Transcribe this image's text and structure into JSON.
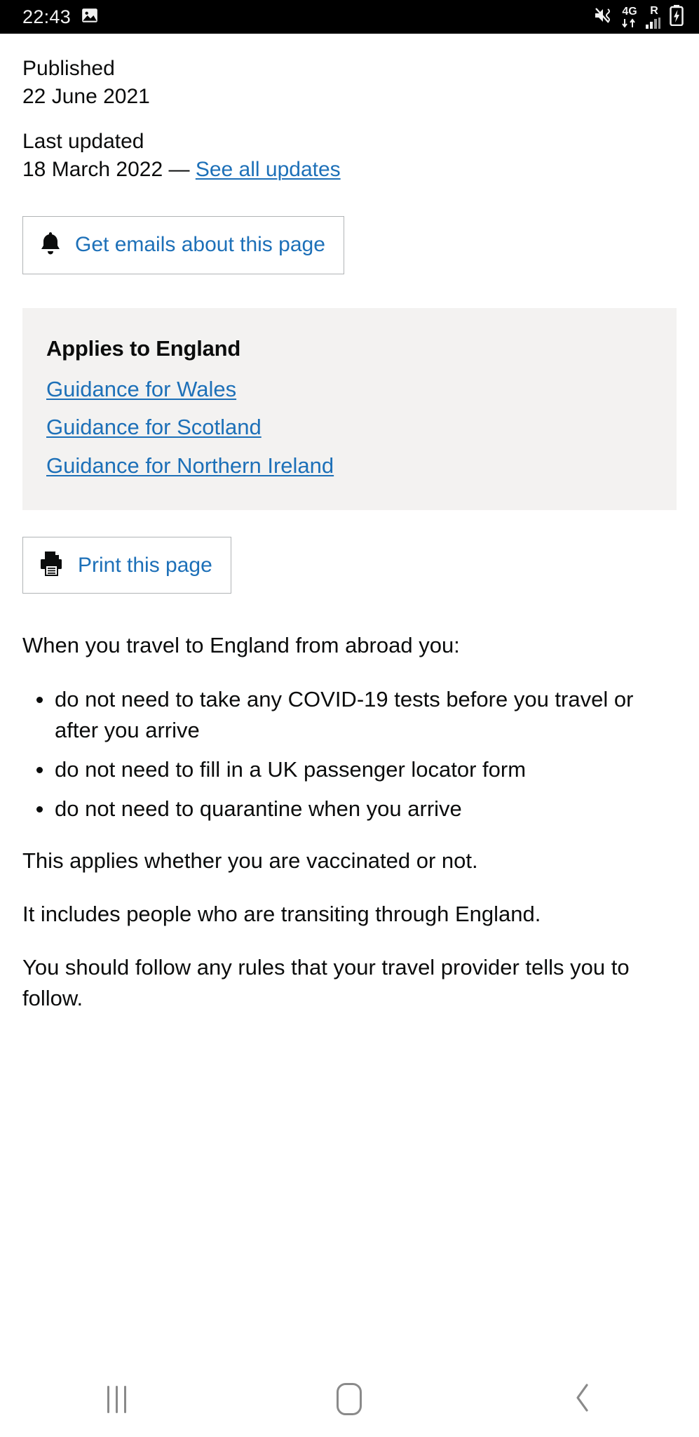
{
  "status_bar": {
    "clock": "22:43",
    "left_icons": [
      "image-icon"
    ],
    "right_icons": [
      "mute-vibrate-icon",
      "signal-bars-icon",
      "battery-charging-icon"
    ],
    "network_label": "4G",
    "roaming_label": "R",
    "background_color": "#000000",
    "foreground_color": "#f2f2f2"
  },
  "meta": {
    "published_label": "Published",
    "published_date": "22 June 2021",
    "updated_label": "Last updated",
    "updated_date": "18 March 2022",
    "dash": "—",
    "updates_link": "See all updates"
  },
  "subscribe": {
    "icon": "bell-icon",
    "label": "Get emails about this page"
  },
  "applies_panel": {
    "title": "Applies to England",
    "links": [
      "Guidance for Wales",
      "Guidance for Scotland",
      "Guidance for Northern Ireland"
    ],
    "background_color": "#f3f2f1"
  },
  "print": {
    "icon": "printer-icon",
    "label": "Print this page"
  },
  "body": {
    "intro": "When you travel to England from abroad you:",
    "bullets": [
      "do not need to take any COVID-19 tests before you travel or after you arrive",
      "do not need to fill in a UK passenger locator form",
      "do not need to quarantine when you arrive"
    ],
    "paragraphs": [
      "This applies whether you are vaccinated or not.",
      "It includes people who are transiting through England.",
      "You should follow any rules that your travel provider tells you to follow."
    ]
  },
  "nav_bar": {
    "buttons": [
      "recents-icon",
      "home-icon",
      "back-icon"
    ]
  },
  "colors": {
    "link": "#1d70b8",
    "text": "#0b0c0c",
    "panel": "#f3f2f1",
    "border": "#b1b4b6"
  }
}
